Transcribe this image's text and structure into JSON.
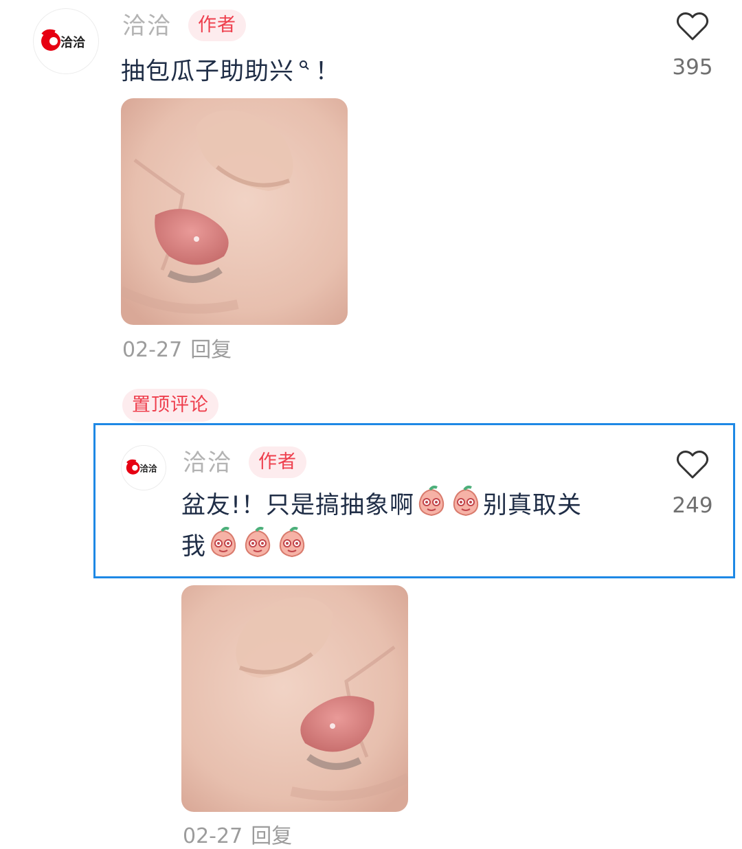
{
  "comments": [
    {
      "username": "洽洽",
      "badge": "作者",
      "text_main": "抽包瓜子助助兴",
      "text_hint_icon": "search-hint-icon",
      "text_end": "！",
      "likes": "395",
      "date": "02-27",
      "reply_label": "回复"
    },
    {
      "pin_label": "置顶评论",
      "username": "洽洽",
      "badge": "作者",
      "text_line1_a": "盆友!！只是搞抽象啊",
      "text_line1_b": "别真取关",
      "text_line2": "我",
      "emoji_icon": "peach-crying-emoji-icon",
      "likes": "249",
      "date": "02-27",
      "reply_label": "回复"
    }
  ],
  "brand": {
    "logo_text": "洽洽",
    "accent_red": "#e60012",
    "badge_text_color": "#ee3f4d",
    "badge_bg": "#fdecee",
    "highlight_blue": "#1e88e5"
  }
}
